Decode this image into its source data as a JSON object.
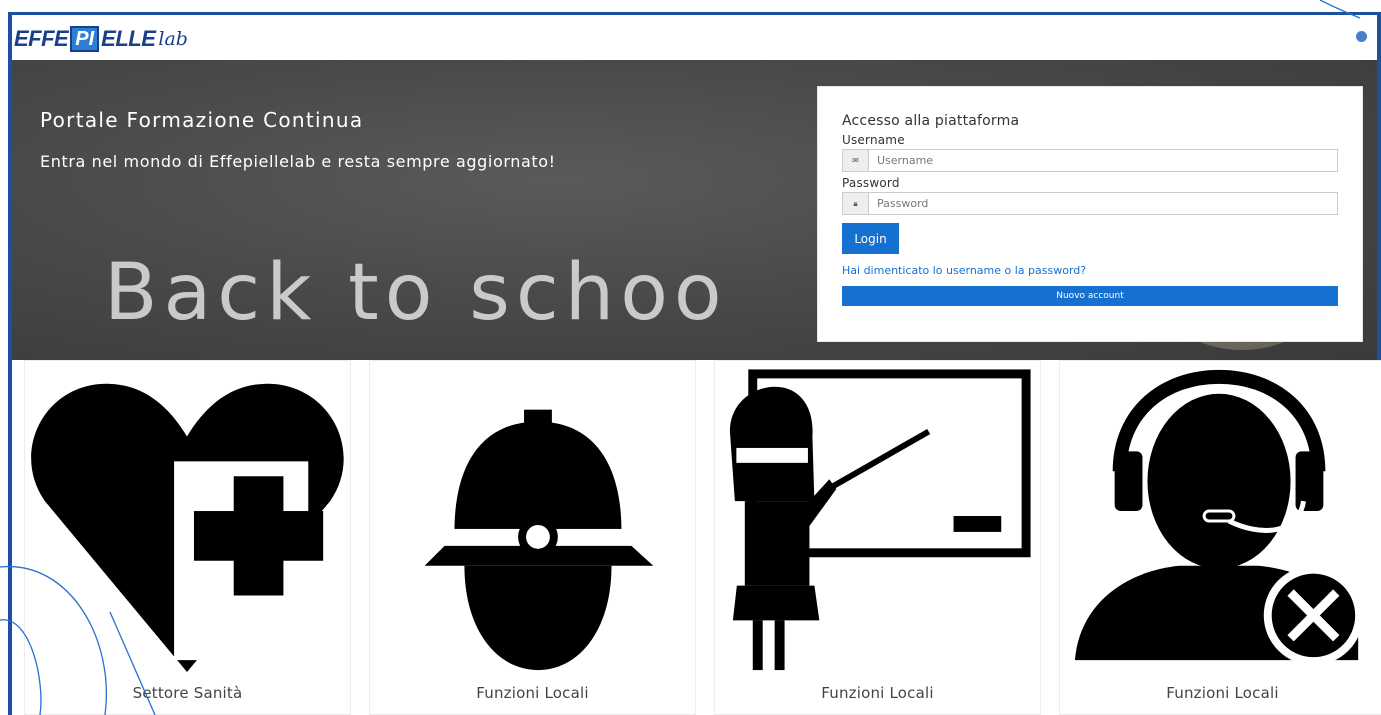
{
  "brand": {
    "logo_part1": "EFFE",
    "logo_part2": "PI",
    "logo_part3": "ELLE",
    "logo_part4": "lab"
  },
  "hero": {
    "title": "Portale Formazione Continua",
    "subtitle": "Entra nel mondo di Effepiellelab e resta sempre aggiornato!",
    "chalk_text": "Back to schoo"
  },
  "login": {
    "heading": "Accesso alla piattaforma",
    "username_label": "Username",
    "username_placeholder": "Username",
    "password_label": "Password",
    "password_placeholder": "Password",
    "login_button": "Login",
    "forgot_link": "Hai dimenticato lo username o la password?",
    "new_account_button": "Nuovo account"
  },
  "cards": [
    {
      "label": "Settore Sanità",
      "icon": "heart-cross-icon"
    },
    {
      "label": "Funzioni Locali",
      "icon": "police-helmet-icon"
    },
    {
      "label": "Funzioni Locali",
      "icon": "teacher-board-icon"
    },
    {
      "label": "Funzioni Locali",
      "icon": "support-agent-icon"
    }
  ],
  "colors": {
    "brand_blue": "#1c3f8a",
    "primary_button": "#1670d0",
    "frame_blue": "#1c4fa0"
  }
}
